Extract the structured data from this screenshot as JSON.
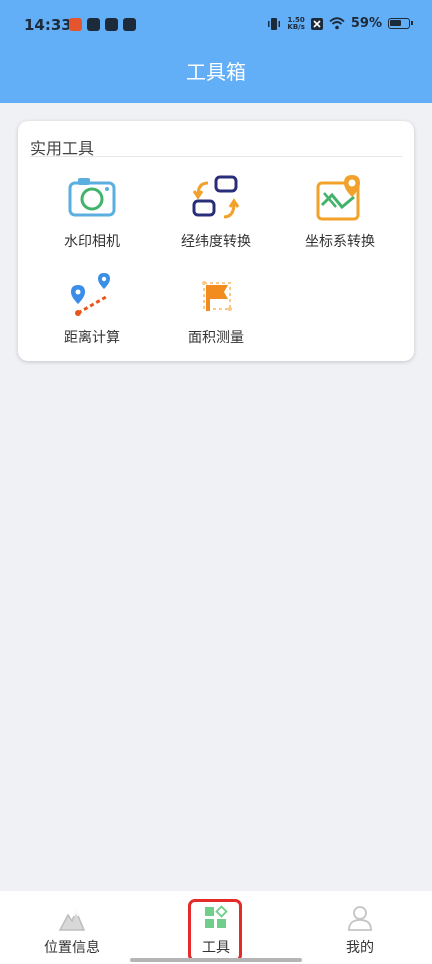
{
  "status": {
    "time": "14:33",
    "speed_top": "1.50",
    "speed_unit": "KB/s",
    "battery": "59%"
  },
  "header": {
    "title": "工具箱"
  },
  "card": {
    "title": "实用工具",
    "tools": [
      {
        "label": "水印相机",
        "icon": "camera-icon"
      },
      {
        "label": "经纬度转换",
        "icon": "swap-icon"
      },
      {
        "label": "坐标系转换",
        "icon": "map-pin-icon"
      },
      {
        "label": "距离计算",
        "icon": "distance-icon"
      },
      {
        "label": "面积测量",
        "icon": "flag-icon"
      }
    ]
  },
  "nav": {
    "items": [
      {
        "label": "位置信息",
        "icon": "mountain-icon"
      },
      {
        "label": "工具",
        "icon": "grid-icon"
      },
      {
        "label": "我的",
        "icon": "user-icon"
      }
    ],
    "active": "工具"
  },
  "colors": {
    "header": "#62aef7",
    "highlight": "#e52a2a",
    "camera": "#5aaee0",
    "swap_navy": "#2a2d7a",
    "swap_orange": "#f2a12a",
    "map_orange": "#f2a12a",
    "map_green": "#42b36b",
    "grid_green": "#6fcf8a"
  }
}
